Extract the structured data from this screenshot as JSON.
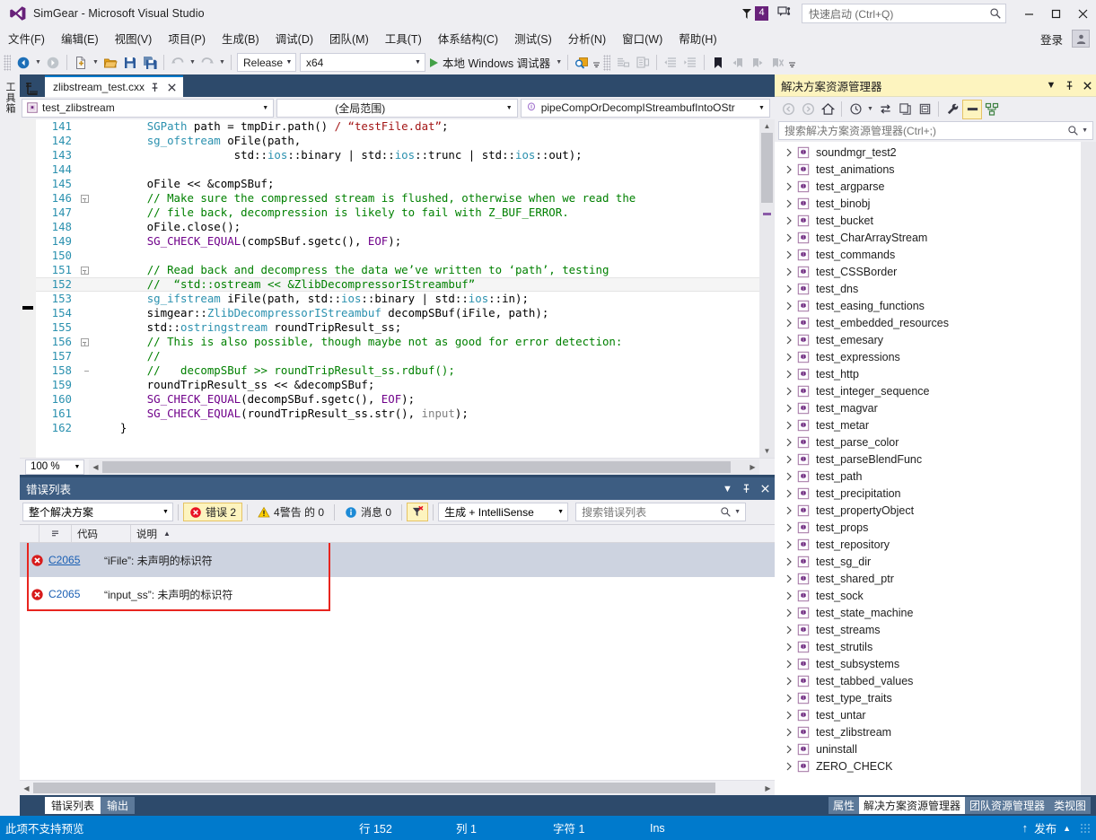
{
  "window": {
    "title": "SimGear - Microsoft Visual Studio",
    "logo_icon": "visual-studio-logo",
    "notification_count": "4",
    "notification_icon": "notification-flag-icon",
    "feedback_icon": "feedback-smiley-icon",
    "minimize_label": "–",
    "maximize_label": "□",
    "close_label": "✕"
  },
  "quick_launch": {
    "placeholder": "快速启动 (Ctrl+Q)",
    "search_icon": "magnifier-icon"
  },
  "menu": {
    "items": [
      {
        "label": "文件(F)"
      },
      {
        "label": "编辑(E)"
      },
      {
        "label": "视图(V)"
      },
      {
        "label": "项目(P)"
      },
      {
        "label": "生成(B)"
      },
      {
        "label": "调试(D)"
      },
      {
        "label": "团队(M)"
      },
      {
        "label": "工具(T)"
      },
      {
        "label": "体系结构(C)"
      },
      {
        "label": "测试(S)"
      },
      {
        "label": "分析(N)"
      },
      {
        "label": "窗口(W)"
      },
      {
        "label": "帮助(H)"
      }
    ],
    "signin_label": "登录",
    "account_icon": "account-avatar-icon"
  },
  "toolbar": {
    "nav_back_icon": "navigate-backward-icon",
    "nav_forward_icon": "navigate-forward-icon",
    "new_item_icon": "new-item-icon",
    "open_icon": "open-file-icon",
    "save_icon": "save-icon",
    "save_all_icon": "save-all-icon",
    "undo_icon": "undo-icon",
    "redo_icon": "redo-icon",
    "config_value": "Release",
    "platform_value": "x64",
    "run_label": "本地 Windows 调试器",
    "run_icon": "play-triangle-icon",
    "find_icon": "find-in-files-icon",
    "comment_icon": "comment-selection-icon",
    "uncomment_icon": "uncomment-selection-icon",
    "outdent_icon": "decrease-indent-icon",
    "indent_icon": "increase-indent-icon",
    "bookmark_icon": "bookmark-icon",
    "prev_bookmark_icon": "previous-bookmark-icon",
    "next_bookmark_icon": "next-bookmark-icon",
    "clear_bookmark_icon": "clear-bookmarks-icon"
  },
  "left_rail": {
    "toolbox_label": "工具箱"
  },
  "editor": {
    "tab": {
      "filename": "zlibstream_test.cxx",
      "pin_icon": "pin-icon",
      "close_icon": "close-icon"
    },
    "navbar": {
      "project_value": "test_zlibstream",
      "project_icon": "project-icon",
      "scope_value": "(全局范围)",
      "member_value": "pipeCompOrDecompIStreambufIntoOStr",
      "member_icon": "method-icon"
    },
    "zoom_level": "100 %",
    "lines": [
      {
        "num": "141",
        "fold": "none",
        "tokens": [
          {
            "t": "        ",
            "c": "plain"
          },
          {
            "t": "SGPath",
            "c": "type"
          },
          {
            "t": " path = tmpDir.path() ",
            "c": "plain"
          },
          {
            "t": "/",
            "c": "str"
          },
          {
            "t": " “testFile.dat”",
            "c": "str"
          },
          {
            "t": ";",
            "c": "plain"
          }
        ]
      },
      {
        "num": "142",
        "fold": "none",
        "tokens": [
          {
            "t": "        ",
            "c": "plain"
          },
          {
            "t": "sg_ofstream",
            "c": "type"
          },
          {
            "t": " oFile(path,",
            "c": "plain"
          }
        ]
      },
      {
        "num": "143",
        "fold": "none",
        "tokens": [
          {
            "t": "                     std::",
            "c": "plain"
          },
          {
            "t": "ios",
            "c": "type"
          },
          {
            "t": "::binary | std::",
            "c": "plain"
          },
          {
            "t": "ios",
            "c": "type"
          },
          {
            "t": "::trunc | std::",
            "c": "plain"
          },
          {
            "t": "ios",
            "c": "type"
          },
          {
            "t": "::out);",
            "c": "plain"
          }
        ]
      },
      {
        "num": "144",
        "fold": "none",
        "tokens": []
      },
      {
        "num": "145",
        "fold": "none",
        "tokens": [
          {
            "t": "        oFile ",
            "c": "plain"
          },
          {
            "t": "<<",
            "c": "op"
          },
          {
            "t": " &compSBuf;",
            "c": "plain"
          }
        ]
      },
      {
        "num": "146",
        "fold": "box",
        "tokens": [
          {
            "t": "        ",
            "c": "plain"
          },
          {
            "t": "// Make sure the compressed stream is flushed, otherwise when we read the",
            "c": "cmt"
          }
        ]
      },
      {
        "num": "147",
        "fold": "bar",
        "tokens": [
          {
            "t": "        ",
            "c": "plain"
          },
          {
            "t": "// file back, decompression is likely to fail with Z_BUF_ERROR.",
            "c": "cmt"
          }
        ]
      },
      {
        "num": "148",
        "fold": "bar",
        "tokens": [
          {
            "t": "        oFile.close();",
            "c": "plain"
          }
        ]
      },
      {
        "num": "149",
        "fold": "bar",
        "tokens": [
          {
            "t": "        ",
            "c": "plain"
          },
          {
            "t": "SG_CHECK_EQUAL",
            "c": "mac"
          },
          {
            "t": "(compSBuf.sgetc(), ",
            "c": "plain"
          },
          {
            "t": "EOF",
            "c": "mac"
          },
          {
            "t": ");",
            "c": "plain"
          }
        ]
      },
      {
        "num": "150",
        "fold": "bar",
        "tokens": []
      },
      {
        "num": "151",
        "fold": "box",
        "tokens": [
          {
            "t": "        ",
            "c": "plain"
          },
          {
            "t": "// Read back and decompress the data we’ve written to ‘path’, testing",
            "c": "cmt"
          }
        ]
      },
      {
        "num": "152",
        "fold": "bar",
        "highlight": true,
        "bookmark": true,
        "tokens": [
          {
            "t": "        ",
            "c": "plain"
          },
          {
            "t": "//  “std::ostream << &ZlibDecompressorIStreambuf”",
            "c": "cmt"
          }
        ]
      },
      {
        "num": "153",
        "fold": "bar",
        "tokens": [
          {
            "t": "        ",
            "c": "plain"
          },
          {
            "t": "sg_ifstream",
            "c": "type"
          },
          {
            "t": " iFile(path, std::",
            "c": "plain"
          },
          {
            "t": "ios",
            "c": "type"
          },
          {
            "t": "::binary | std::",
            "c": "plain"
          },
          {
            "t": "ios",
            "c": "type"
          },
          {
            "t": "::in);",
            "c": "plain"
          }
        ]
      },
      {
        "num": "154",
        "fold": "bar",
        "tokens": [
          {
            "t": "        simgear::",
            "c": "plain"
          },
          {
            "t": "ZlibDecompressorIStreambuf",
            "c": "type"
          },
          {
            "t": " decompSBuf(iFile, path);",
            "c": "plain"
          }
        ]
      },
      {
        "num": "155",
        "fold": "bar",
        "tokens": [
          {
            "t": "        std::",
            "c": "plain"
          },
          {
            "t": "ostringstream",
            "c": "type"
          },
          {
            "t": " roundTripResult_ss;",
            "c": "plain"
          }
        ]
      },
      {
        "num": "156",
        "fold": "box",
        "tokens": [
          {
            "t": "        ",
            "c": "plain"
          },
          {
            "t": "// This is also possible, though maybe not as good for error detection:",
            "c": "cmt"
          }
        ]
      },
      {
        "num": "157",
        "fold": "bar",
        "tokens": [
          {
            "t": "        ",
            "c": "plain"
          },
          {
            "t": "//",
            "c": "cmt"
          }
        ]
      },
      {
        "num": "158",
        "fold": "barend",
        "tokens": [
          {
            "t": "        ",
            "c": "plain"
          },
          {
            "t": "//   decompSBuf >> roundTripResult_ss.rdbuf();",
            "c": "cmt"
          }
        ]
      },
      {
        "num": "159",
        "fold": "none",
        "tokens": [
          {
            "t": "        roundTripResult_ss ",
            "c": "plain"
          },
          {
            "t": "<<",
            "c": "op"
          },
          {
            "t": " &decompSBuf;",
            "c": "plain"
          }
        ]
      },
      {
        "num": "160",
        "fold": "none",
        "tokens": [
          {
            "t": "        ",
            "c": "plain"
          },
          {
            "t": "SG_CHECK_EQUAL",
            "c": "mac"
          },
          {
            "t": "(decompSBuf.sgetc(), ",
            "c": "plain"
          },
          {
            "t": "EOF",
            "c": "mac"
          },
          {
            "t": ");",
            "c": "plain"
          }
        ]
      },
      {
        "num": "161",
        "fold": "none",
        "tokens": [
          {
            "t": "        ",
            "c": "plain"
          },
          {
            "t": "SG_CHECK_EQUAL",
            "c": "mac"
          },
          {
            "t": "(roundTripResult_ss.str(), ",
            "c": "plain"
          },
          {
            "t": "input",
            "c": "gray"
          },
          {
            "t": ");",
            "c": "plain"
          }
        ]
      },
      {
        "num": "162",
        "fold": "none",
        "tokens": [
          {
            "t": "    }",
            "c": "plain"
          }
        ]
      }
    ]
  },
  "error_list": {
    "title": "错误列表",
    "dropdown_icon": "chevron-down-icon",
    "pin_icon": "pin-icon",
    "close_icon": "close-icon",
    "scope_value": "整个解决方案",
    "errors_label": "错误 2",
    "errors_icon": "error-circle-icon",
    "warnings_label": "4警告 的 0",
    "warnings_icon": "warning-triangle-icon",
    "messages_label": "消息 0",
    "messages_icon": "info-circle-icon",
    "filter_icon": "clear-filter-icon",
    "build_filter_value": "生成 + IntelliSense",
    "search_placeholder": "搜索错误列表",
    "search_icon": "magnifier-icon",
    "columns": [
      {
        "label": ""
      },
      {
        "label": ""
      },
      {
        "label": "代码"
      },
      {
        "label": "说明",
        "sort": "▲"
      }
    ],
    "rows": [
      {
        "icon": "error-circle-icon",
        "code": "C2065",
        "description": "“iFile”: 未声明的标识符",
        "selected": true
      },
      {
        "icon": "error-circle-icon",
        "code": "C2065",
        "description": "“input_ss”: 未声明的标识符",
        "selected": false
      }
    ],
    "tabs": [
      {
        "label": "错误列表",
        "active": true
      },
      {
        "label": "输出",
        "active": false
      }
    ]
  },
  "solution_explorer": {
    "title": "解决方案资源管理器",
    "dropdown_icon": "chevron-down-icon",
    "pin_icon": "pin-icon",
    "close_icon": "close-icon",
    "toolbar": {
      "back_icon": "navigate-back-icon",
      "forward_icon": "navigate-forward-icon",
      "home_icon": "home-icon",
      "pending_changes_icon": "pending-changes-icon",
      "sync_icon": "sync-with-active-document-icon",
      "refresh_icon": "refresh-icon",
      "collapse_all_icon": "collapse-all-icon",
      "properties_icon": "properties-wrench-icon",
      "show_all_files_icon": "show-all-files-icon",
      "view_code_icon": "view-class-diagram-icon"
    },
    "search_placeholder": "搜索解决方案资源管理器(Ctrl+;)",
    "search_icon": "magnifier-icon",
    "expander_icon": "chevron-right-icon",
    "project_icon": "cpp-project-icon",
    "items": [
      {
        "label": "soundmgr_test2"
      },
      {
        "label": "test_animations"
      },
      {
        "label": "test_argparse"
      },
      {
        "label": "test_binobj"
      },
      {
        "label": "test_bucket"
      },
      {
        "label": "test_CharArrayStream"
      },
      {
        "label": "test_commands"
      },
      {
        "label": "test_CSSBorder"
      },
      {
        "label": "test_dns"
      },
      {
        "label": "test_easing_functions"
      },
      {
        "label": "test_embedded_resources"
      },
      {
        "label": "test_emesary"
      },
      {
        "label": "test_expressions"
      },
      {
        "label": "test_http"
      },
      {
        "label": "test_integer_sequence"
      },
      {
        "label": "test_magvar"
      },
      {
        "label": "test_metar"
      },
      {
        "label": "test_parse_color"
      },
      {
        "label": "test_parseBlendFunc"
      },
      {
        "label": "test_path"
      },
      {
        "label": "test_precipitation"
      },
      {
        "label": "test_propertyObject"
      },
      {
        "label": "test_props"
      },
      {
        "label": "test_repository"
      },
      {
        "label": "test_sg_dir"
      },
      {
        "label": "test_shared_ptr"
      },
      {
        "label": "test_sock"
      },
      {
        "label": "test_state_machine"
      },
      {
        "label": "test_streams"
      },
      {
        "label": "test_strutils"
      },
      {
        "label": "test_subsystems"
      },
      {
        "label": "test_tabbed_values"
      },
      {
        "label": "test_type_traits"
      },
      {
        "label": "test_untar"
      },
      {
        "label": "test_zlibstream"
      },
      {
        "label": "uninstall"
      },
      {
        "label": "ZERO_CHECK"
      }
    ],
    "tabs": [
      {
        "label": "属性",
        "active": false
      },
      {
        "label": "解决方案资源管理器",
        "active": true
      },
      {
        "label": "团队资源管理器",
        "active": false
      },
      {
        "label": "类视图",
        "active": false
      }
    ]
  },
  "status_bar": {
    "message": "此项不支持预览",
    "line_label": "行 152",
    "column_label": "列 1",
    "char_label": "字符 1",
    "insert_mode": "Ins",
    "publish_label": "发布",
    "publish_up_icon": "arrow-up-icon",
    "publish_expand_icon": "chevron-up-icon"
  },
  "colors": {
    "accent": "#007acc",
    "title_bar_bg": "#eeeef2",
    "panel_header_bg": "#3d5d82",
    "solexp_header_bg": "#fdf4bf",
    "error_red": "#e8251f",
    "badge_purple": "#68217a",
    "comment_green": "#008000",
    "keyword_blue": "#0000ff",
    "type_teal": "#2b91af",
    "macro_purple": "#6f008a",
    "string_red": "#a31515"
  }
}
